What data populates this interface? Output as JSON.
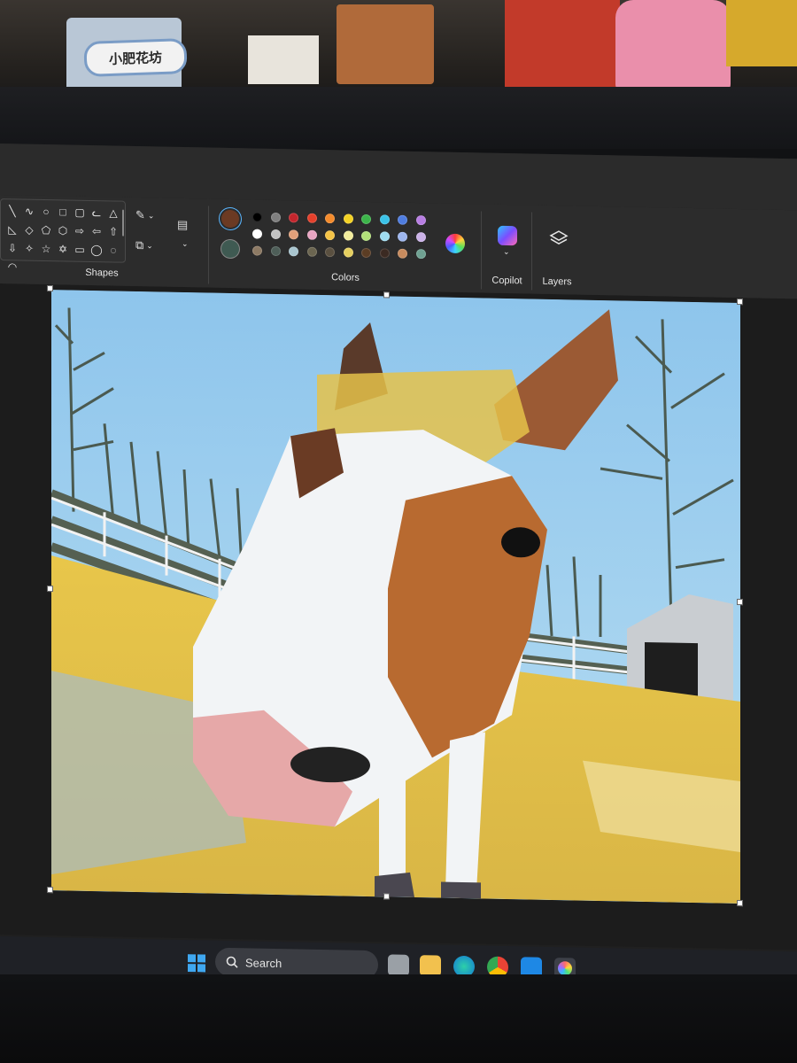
{
  "shelf": {
    "sign_text": "小肥花坊"
  },
  "ribbon": {
    "groups": {
      "shapes_label": "Shapes",
      "colors_label": "Colors",
      "copilot_label": "Copilot",
      "layers_label": "Layers"
    },
    "shape_icons": [
      "╲",
      "∿",
      "○",
      "□",
      "▢",
      "ᓚ",
      "△",
      "◺",
      "◇",
      "⬠",
      "⬡",
      "⇨",
      "⇦",
      "⇧",
      "⇩",
      "✧",
      "☆",
      "✡",
      "▭",
      "◯",
      "◌",
      "◠"
    ],
    "current_colors": {
      "primary": "#6b3a23",
      "secondary": "#3f5a52"
    },
    "palette_row1": [
      "#000000",
      "#7f7f7f",
      "#c3262d",
      "#e5402b",
      "#f58b2c",
      "#f4d224",
      "#3cb54a",
      "#3ac2e8",
      "#4f7de0",
      "#b87ee3"
    ],
    "palette_row2": [
      "#ffffff",
      "#c3c3c3",
      "#e1a07a",
      "#e8a5c2",
      "#f6c446",
      "#f2ec9c",
      "#b2e07a",
      "#9fdcf0",
      "#9db6ee",
      "#cbb2e8"
    ],
    "palette_row3": [
      "#8d7a64",
      "#4e5e58",
      "#a9c5cf",
      "#6b6550",
      "#5a5040",
      "#e5cf5f",
      "#5b3d24",
      "#3b2a22",
      "#c78b5e",
      "#6fa192"
    ]
  },
  "taskbar": {
    "search_placeholder": "Search",
    "apps": [
      "windows-start",
      "file-explorer",
      "edge",
      "chrome",
      "copilot",
      "paint"
    ]
  }
}
